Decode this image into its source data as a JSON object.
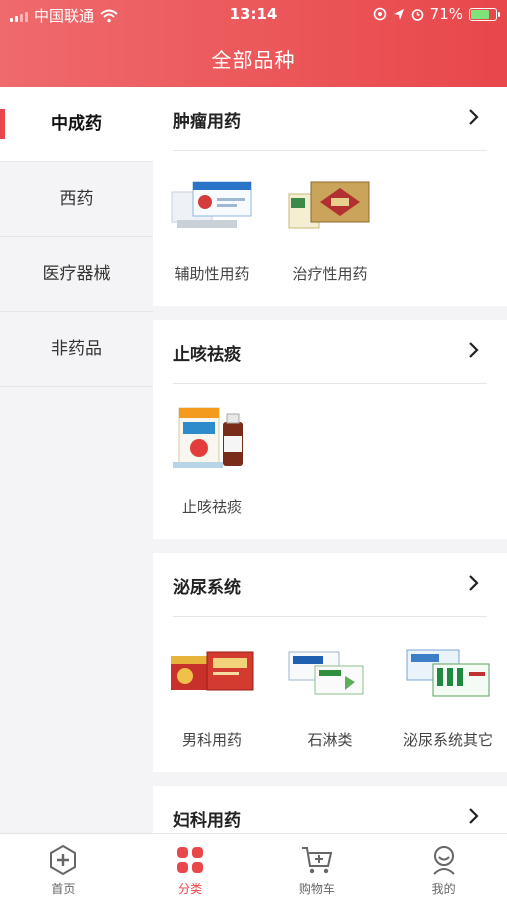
{
  "status_bar": {
    "carrier": "中国联通",
    "time": "13:14",
    "battery": "71%"
  },
  "header": {
    "title": "全部品种"
  },
  "sidebar": {
    "items": [
      {
        "label": "中成药",
        "active": true
      },
      {
        "label": "西药",
        "active": false
      },
      {
        "label": "医疗器械",
        "active": false
      },
      {
        "label": "非药品",
        "active": false
      }
    ]
  },
  "sections": [
    {
      "title": "肿瘤用药",
      "items": [
        {
          "label": "辅助性用药"
        },
        {
          "label": "治疗性用药"
        }
      ]
    },
    {
      "title": "止咳祛痰",
      "items": [
        {
          "label": "止咳祛痰"
        }
      ]
    },
    {
      "title": "泌尿系统",
      "items": [
        {
          "label": "男科用药"
        },
        {
          "label": "石淋类"
        },
        {
          "label": "泌尿系统其它"
        }
      ]
    },
    {
      "title": "妇科用药",
      "items": []
    }
  ],
  "tabbar": {
    "tabs": [
      {
        "label": "首页",
        "icon": "home-plus-icon"
      },
      {
        "label": "分类",
        "icon": "category-icon",
        "active": true
      },
      {
        "label": "购物车",
        "icon": "cart-icon"
      },
      {
        "label": "我的",
        "icon": "profile-icon"
      }
    ]
  },
  "colors": {
    "brand_red": "#e8474b",
    "header_gradient_start": "#ef6a6c"
  }
}
